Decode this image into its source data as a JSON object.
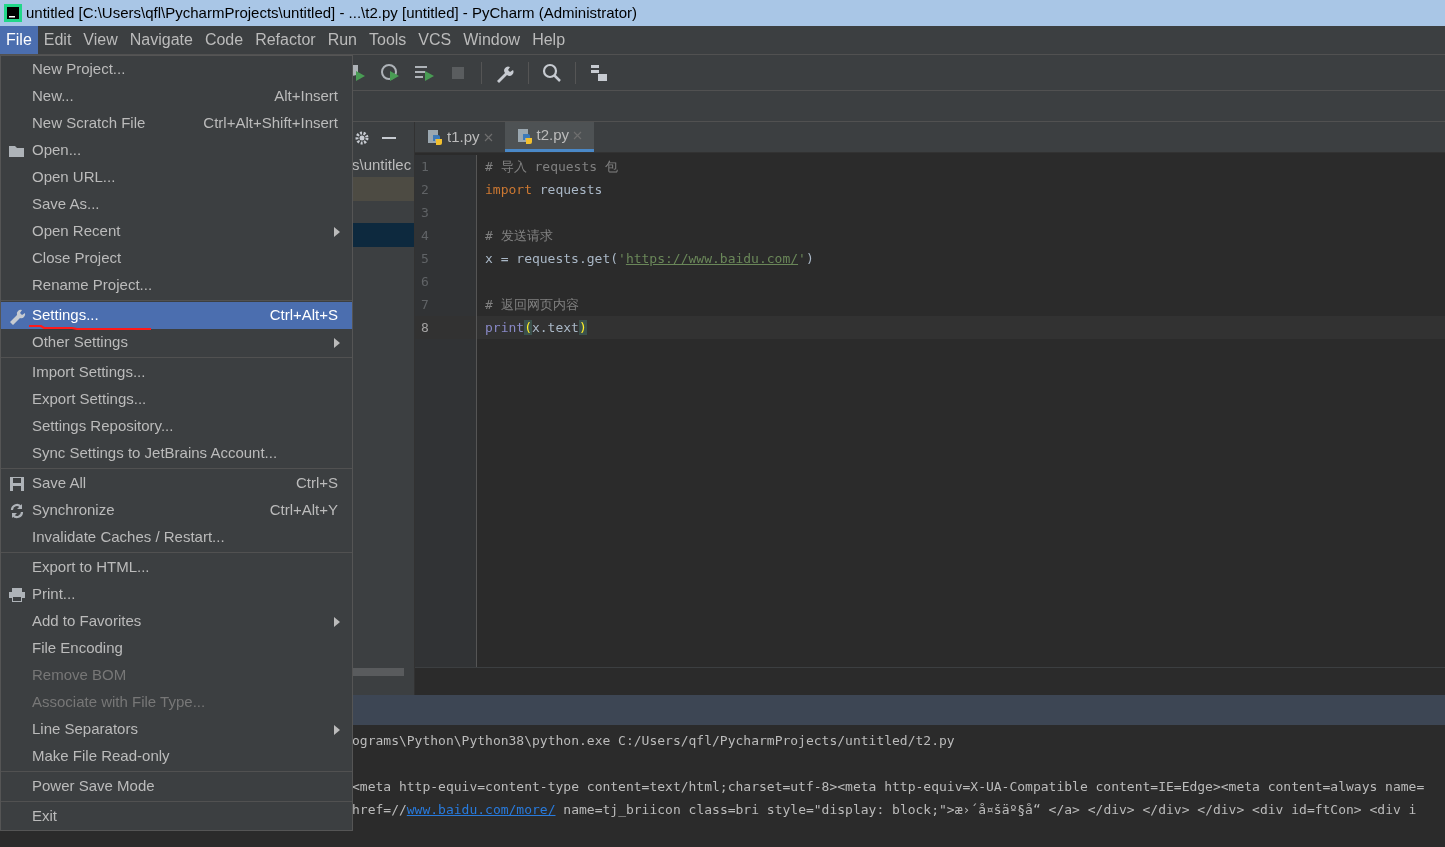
{
  "window": {
    "title": "untitled [C:\\Users\\qfl\\PycharmProjects\\untitled] - ...\\t2.py [untitled] - PyCharm (Administrator)"
  },
  "menubar": [
    {
      "label": "File",
      "selected": true
    },
    {
      "label": "Edit",
      "selected": false
    },
    {
      "label": "View",
      "selected": false
    },
    {
      "label": "Navigate",
      "selected": false
    },
    {
      "label": "Code",
      "selected": false
    },
    {
      "label": "Refactor",
      "selected": false
    },
    {
      "label": "Run",
      "selected": false
    },
    {
      "label": "Tools",
      "selected": false
    },
    {
      "label": "VCS",
      "selected": false
    },
    {
      "label": "Window",
      "selected": false
    },
    {
      "label": "Help",
      "selected": false
    }
  ],
  "file_menu": [
    {
      "kind": "item",
      "label": "New Project...",
      "submenu": false,
      "disabled": false,
      "selected": false
    },
    {
      "kind": "item",
      "label": "New...",
      "shortcut": "Alt+Insert",
      "submenu": false,
      "disabled": false,
      "selected": false
    },
    {
      "kind": "item",
      "label": "New Scratch File",
      "shortcut": "Ctrl+Alt+Shift+Insert",
      "submenu": false,
      "disabled": false,
      "selected": false
    },
    {
      "kind": "item",
      "label": "Open...",
      "submenu": false,
      "disabled": false,
      "selected": false
    },
    {
      "kind": "item",
      "label": "Open URL...",
      "submenu": false,
      "disabled": false,
      "selected": false
    },
    {
      "kind": "item",
      "label": "Save As...",
      "submenu": false,
      "disabled": false,
      "selected": false
    },
    {
      "kind": "item",
      "label": "Open Recent",
      "submenu": true,
      "disabled": false,
      "selected": false
    },
    {
      "kind": "item",
      "label": "Close Project",
      "submenu": false,
      "disabled": false,
      "selected": false
    },
    {
      "kind": "item",
      "label": "Rename Project...",
      "submenu": false,
      "disabled": false,
      "selected": false
    },
    {
      "kind": "separator"
    },
    {
      "kind": "item",
      "label": "Settings...",
      "shortcut": "Ctrl+Alt+S",
      "submenu": false,
      "disabled": false,
      "selected": true
    },
    {
      "kind": "item",
      "label": "Other Settings",
      "submenu": true,
      "disabled": false,
      "selected": false
    },
    {
      "kind": "separator"
    },
    {
      "kind": "item",
      "label": "Import Settings...",
      "submenu": false,
      "disabled": false,
      "selected": false
    },
    {
      "kind": "item",
      "label": "Export Settings...",
      "submenu": false,
      "disabled": false,
      "selected": false
    },
    {
      "kind": "item",
      "label": "Settings Repository...",
      "submenu": false,
      "disabled": false,
      "selected": false
    },
    {
      "kind": "item",
      "label": "Sync Settings to JetBrains Account...",
      "submenu": false,
      "disabled": false,
      "selected": false
    },
    {
      "kind": "separator"
    },
    {
      "kind": "item",
      "label": "Save All",
      "shortcut": "Ctrl+S",
      "submenu": false,
      "disabled": false,
      "selected": false
    },
    {
      "kind": "item",
      "label": "Synchronize",
      "shortcut": "Ctrl+Alt+Y",
      "submenu": false,
      "disabled": false,
      "selected": false
    },
    {
      "kind": "item",
      "label": "Invalidate Caches / Restart...",
      "submenu": false,
      "disabled": false,
      "selected": false
    },
    {
      "kind": "separator"
    },
    {
      "kind": "item",
      "label": "Export to HTML...",
      "submenu": false,
      "disabled": false,
      "selected": false
    },
    {
      "kind": "item",
      "label": "Print...",
      "submenu": false,
      "disabled": false,
      "selected": false
    },
    {
      "kind": "item",
      "label": "Add to Favorites",
      "submenu": true,
      "disabled": false,
      "selected": false
    },
    {
      "kind": "item",
      "label": "File Encoding",
      "submenu": false,
      "disabled": false,
      "selected": false
    },
    {
      "kind": "item",
      "label": "Remove BOM",
      "submenu": false,
      "disabled": true,
      "selected": false
    },
    {
      "kind": "item",
      "label": "Associate with File Type...",
      "submenu": false,
      "disabled": true,
      "selected": false
    },
    {
      "kind": "item",
      "label": "Line Separators",
      "submenu": true,
      "disabled": false,
      "selected": false
    },
    {
      "kind": "item",
      "label": "Make File Read-only",
      "submenu": false,
      "disabled": false,
      "selected": false
    },
    {
      "kind": "separator"
    },
    {
      "kind": "item",
      "label": "Power Save Mode",
      "submenu": false,
      "disabled": false,
      "selected": false
    },
    {
      "kind": "separator"
    },
    {
      "kind": "item",
      "label": "Exit",
      "submenu": false,
      "disabled": false,
      "selected": false
    }
  ],
  "project_panel": {
    "path": "s\\untitlec"
  },
  "tabs": [
    {
      "label": "t1.py",
      "selected": false
    },
    {
      "label": "t2.py",
      "selected": true
    }
  ],
  "editor": {
    "lines": [
      {
        "number": "1",
        "current": false,
        "tokens": [
          {
            "kind": "comment",
            "text": "# 导入 requests 包"
          }
        ]
      },
      {
        "number": "2",
        "current": false,
        "tokens": [
          {
            "kind": "keyword",
            "text": "import"
          },
          {
            "kind": "plain",
            "text": " requests"
          }
        ]
      },
      {
        "number": "3",
        "current": false
      },
      {
        "number": "4",
        "current": false,
        "tokens": [
          {
            "kind": "comment",
            "text": "# 发送请求"
          }
        ]
      },
      {
        "number": "5",
        "current": false,
        "tokens": [
          {
            "kind": "plain",
            "text": "x = requests.get("
          },
          {
            "kind": "string",
            "text": "'"
          },
          {
            "kind": "link",
            "text": "https://www.baidu.com/"
          },
          {
            "kind": "string",
            "text": "'"
          },
          {
            "kind": "plain",
            "text": ")"
          }
        ]
      },
      {
        "number": "6",
        "current": false
      },
      {
        "number": "7",
        "current": false,
        "tokens": [
          {
            "kind": "comment",
            "text": "# 返回网页内容"
          }
        ]
      },
      {
        "number": "8",
        "current": true,
        "tokens": [
          {
            "kind": "builtin",
            "text": "print"
          },
          {
            "kind": "brace",
            "text": "("
          },
          {
            "kind": "plain",
            "text": "x.text"
          },
          {
            "kind": "brace",
            "text": ")"
          }
        ]
      }
    ]
  },
  "console": {
    "lines": [
      [
        {
          "kind": "plain",
          "text": "ograms\\Python\\Python38\\python.exe C:/Users/qfl/PycharmProjects/untitled/t2.py"
        }
      ],
      [
        {
          "kind": "plain",
          "text": "<meta http-equiv=content-type content=text/html;charset=utf-8><meta http-equiv=X-UA-Compatible content=IE=Edge><meta content=always name="
        }
      ],
      [
        {
          "kind": "plain",
          "text": "href=//"
        },
        {
          "kind": "link",
          "text": "www.baidu.com/more/"
        },
        {
          "kind": "plain",
          "text": " name=tj_briicon class=bri style=\"display: block;\">æ›´å¤šäº§å“ </a> </div> </div> </div> <div id=ftCon> <div i"
        }
      ]
    ]
  }
}
